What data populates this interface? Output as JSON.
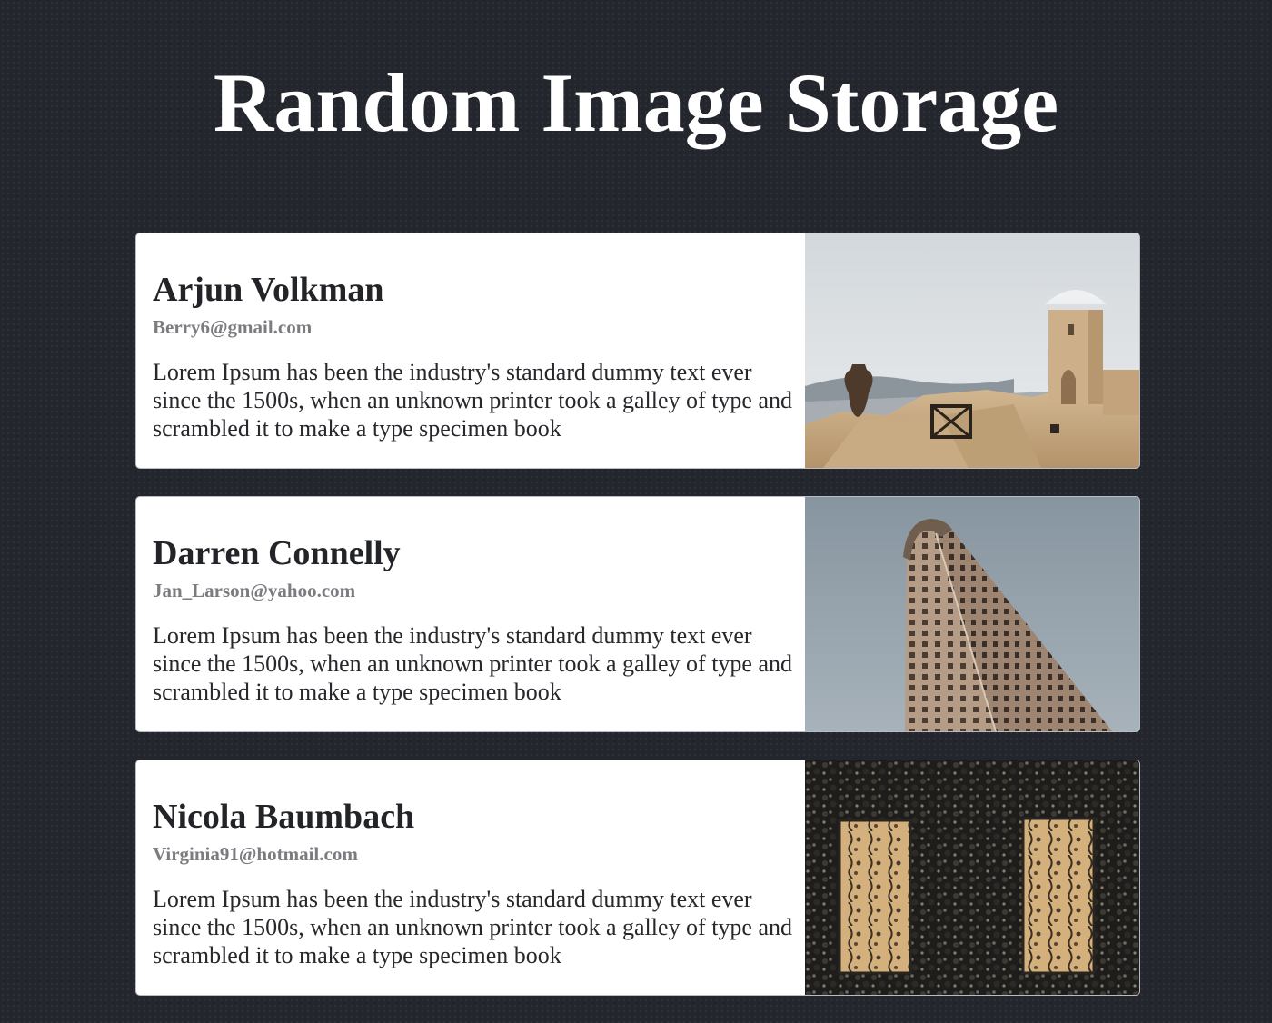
{
  "header": {
    "title": "Random Image Storage"
  },
  "cards": [
    {
      "name": "Arjun Volkman",
      "email": "Berry6@gmail.com",
      "description": "Lorem Ipsum has been the industry's standard dummy text ever since the 1500s, when an unknown printer took a galley of type and scrambled it to make a type specimen book",
      "image": "white-village-rooftops-photo"
    },
    {
      "name": "Darren Connelly",
      "email": "Jan_Larson@yahoo.com",
      "description": "Lorem Ipsum has been the industry's standard dummy text ever since the 1500s, when an unknown printer took a galley of type and scrambled it to make a type specimen book",
      "image": "flatiron-building-photo"
    },
    {
      "name": "Nicola Baumbach",
      "email": "Virginia91@hotmail.com",
      "description": "Lorem Ipsum has been the industry's standard dummy text ever since the 1500s, when an unknown printer took a galley of type and scrambled it to make a type specimen book",
      "image": "ivy-covered-windows-photo"
    }
  ],
  "colors": {
    "background": "#24262d",
    "card": "#ffffff",
    "name_text": "#222428",
    "email_text": "#7a7c80"
  }
}
